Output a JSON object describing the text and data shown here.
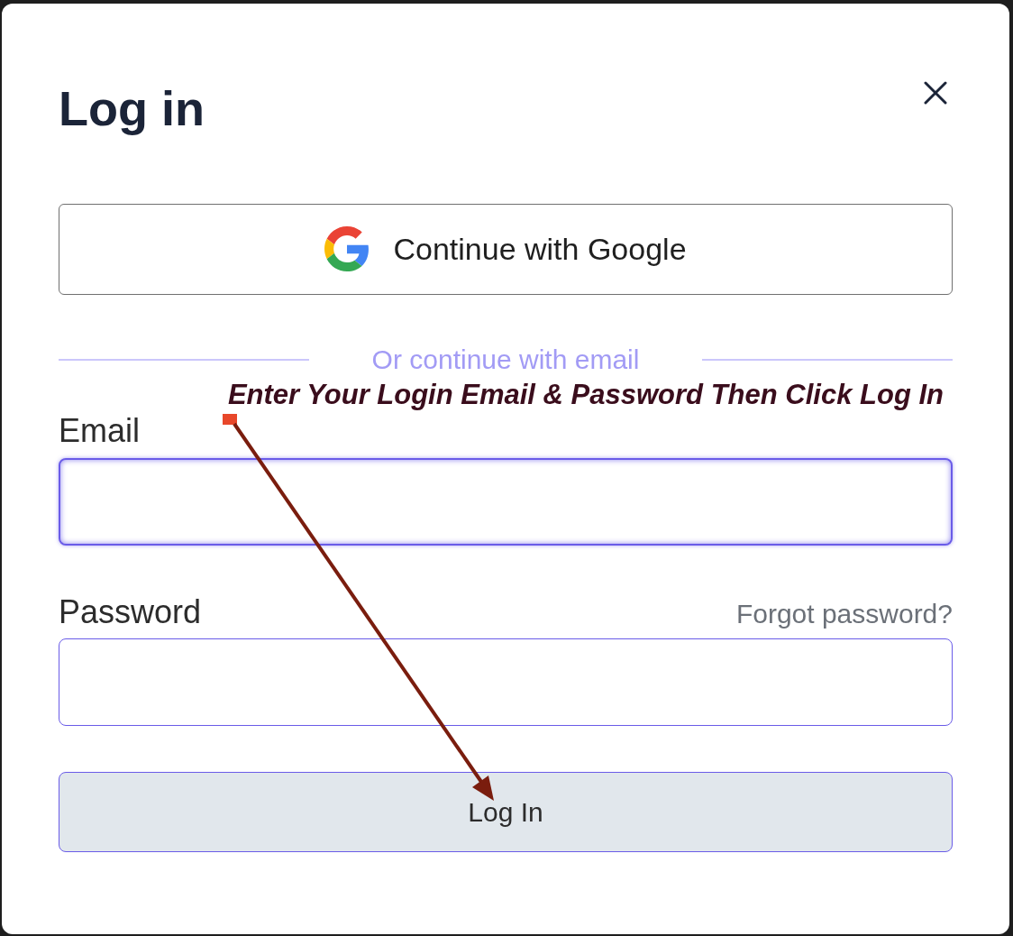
{
  "dialog": {
    "title": "Log in"
  },
  "google_button": {
    "label": "Continue with Google"
  },
  "divider": {
    "text": "Or continue with email"
  },
  "annotation": {
    "text": "Enter Your Login Email & Password Then Click Log In"
  },
  "fields": [
    {
      "label": "Email",
      "focused": true
    },
    {
      "label": "Password",
      "focused": false,
      "link": "Forgot password?"
    }
  ],
  "submit_button": {
    "label": "Log In"
  }
}
